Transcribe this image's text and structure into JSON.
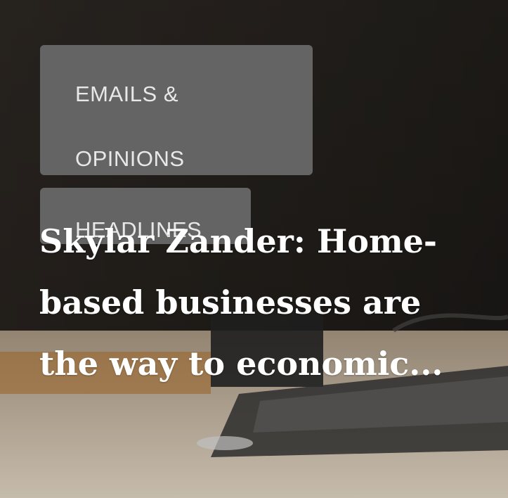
{
  "categories": {
    "emails_label": "EMAILS & OPINIONS",
    "headlines_label": "HEADLINES"
  },
  "article": {
    "headline": "Skylar Zander: Home-based businesses are the way to economic..."
  },
  "colors": {
    "badge_bg": "#646464",
    "badge_text": "#e8e8e8",
    "headline_text": "#ffffff"
  }
}
